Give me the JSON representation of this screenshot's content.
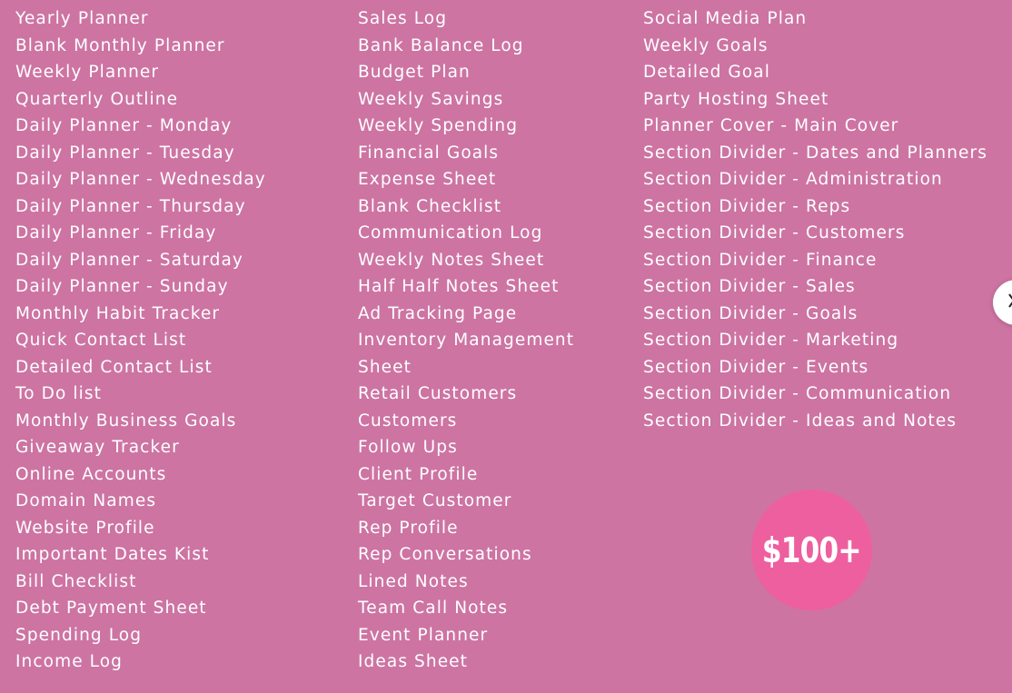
{
  "columns": {
    "left": [
      "Yearly Planner",
      "Blank Monthly Planner",
      "Weekly Planner",
      "Quarterly Outline",
      "Daily Planner - Monday",
      "Daily Planner - Tuesday",
      "Daily Planner - Wednesday",
      "Daily Planner - Thursday",
      "Daily Planner - Friday",
      "Daily Planner - Saturday",
      "Daily Planner - Sunday",
      "Monthly Habit Tracker",
      "Quick Contact List",
      "Detailed Contact List",
      "To Do list",
      "Monthly Business Goals",
      "Giveaway Tracker",
      "Online Accounts",
      "Domain Names",
      "Website Profile",
      "Important Dates Kist",
      "Bill Checklist",
      "Debt Payment Sheet",
      "Spending Log",
      "Income Log"
    ],
    "middle": [
      "Sales Log",
      "Bank Balance Log",
      "Budget Plan",
      "Weekly Savings",
      "Weekly Spending",
      "Financial Goals",
      "Expense Sheet",
      "Blank Checklist",
      "Communication Log",
      "Weekly Notes Sheet",
      "Half Half Notes Sheet",
      "Ad Tracking Page",
      "Inventory Management",
      "Sheet",
      "Retail Customers",
      "Customers",
      "Follow Ups",
      "Client Profile",
      "Target Customer",
      "Rep Profile",
      "Rep Conversations",
      "Lined Notes",
      "Team Call Notes",
      "Event Planner",
      "Ideas Sheet"
    ],
    "right": [
      "Social Media Plan",
      "Weekly Goals",
      "Detailed Goal",
      "Party Hosting Sheet",
      "Planner Cover - Main Cover",
      "Section Divider - Dates and Planners",
      "Section Divider - Administration",
      "Section Divider - Reps",
      "Section Divider - Customers",
      "Section Divider - Finance",
      "Section Divider - Sales",
      "Section Divider - Goals",
      "Section Divider - Marketing",
      "Section Divider - Events",
      "Section Divider - Communication",
      "Section Divider - Ideas and Notes"
    ]
  },
  "badge": {
    "price": "$100+"
  },
  "controls": {
    "next_icon": "chevron-right-icon"
  },
  "colors": {
    "background": "#cd74a3",
    "badge": "#ee5f9f",
    "text": "#ffffff"
  }
}
